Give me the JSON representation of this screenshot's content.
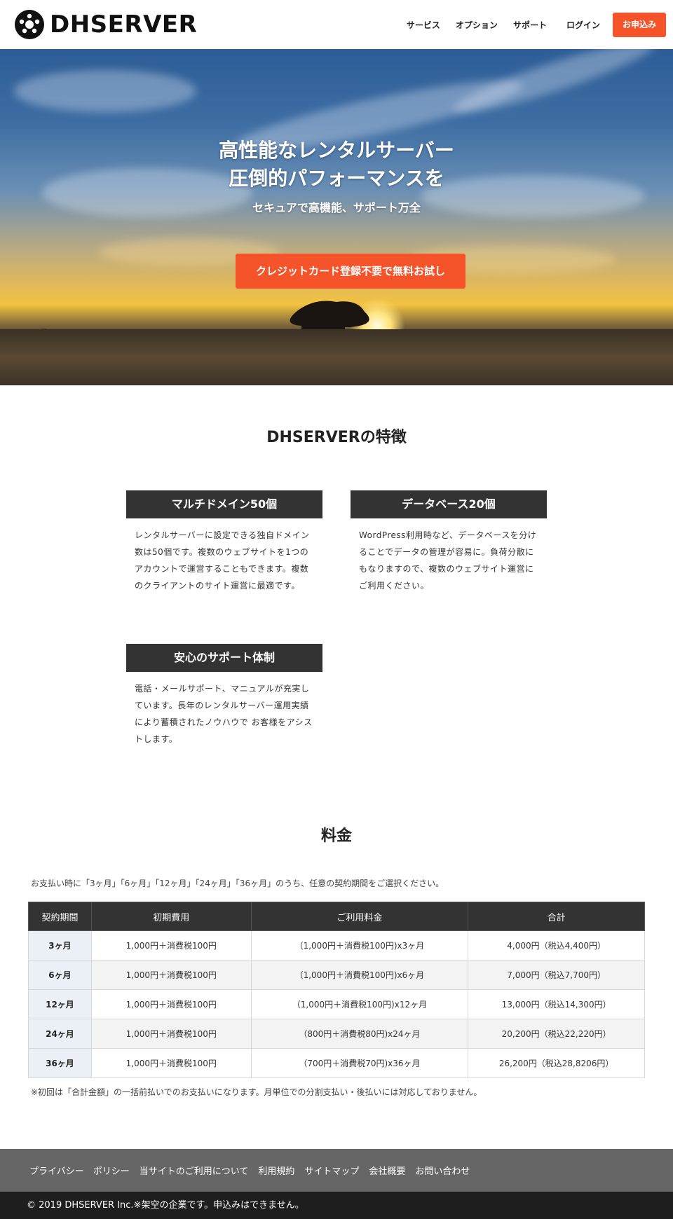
{
  "header": {
    "logo_text": "DHSERVER",
    "nav": [
      "サービス",
      "オプション",
      "サポート",
      "ログイン"
    ],
    "cta": "お申込み"
  },
  "hero": {
    "title_line1": "高性能なレンタルサーバー",
    "title_line2": "圧倒的パフォーマンスを",
    "subtitle": "セキュアで高機能、サポート万全",
    "button": "クレジットカード登録不要で無料お試し"
  },
  "features": {
    "title": "DHSERVERの特徴",
    "items": [
      {
        "heading": "マルチドメイン50個",
        "text": "レンタルサーバーに設定できる独自ドメイン数は50個です。複数のウェブサイトを1つのアカウントで運営することもできます。複数のクライアントのサイト運営に最適です。"
      },
      {
        "heading": "データベース20個",
        "text": "WordPress利用時など、データベースを分けることでデータの管理が容易に。負荷分散にもなりますので、複数のウェブサイト運営にご利用ください。"
      },
      {
        "heading": "安心のサポート体制",
        "text": "電話・メールサポート、マニュアルが充実しています。長年のレンタルサーバー運用実績により蓄積されたノウハウで お客様をアシストします。"
      }
    ]
  },
  "pricing": {
    "title": "料金",
    "note": "お支払い時に「3ヶ月」「6ヶ月」「12ヶ月」「24ヶ月」「36ヶ月」のうち、任意の契約期間をご選択ください。",
    "headers": [
      "契約期間",
      "初期費用",
      "ご利用料金",
      "合計"
    ],
    "rows": [
      [
        "3ヶ月",
        "1,000円＋消費税100円",
        "（1,000円＋消費税100円)x3ヶ月",
        "4,000円（税込4,400円）"
      ],
      [
        "6ヶ月",
        "1,000円＋消費税100円",
        "（1,000円＋消費税100円)x6ヶ月",
        "7,000円（税込7,700円）"
      ],
      [
        "12ヶ月",
        "1,000円＋消費税100円",
        "（1,000円＋消費税100円)x12ヶ月",
        "13,000円（税込14,300円）"
      ],
      [
        "24ヶ月",
        "1,000円＋消費税100円",
        "（800円＋消費税80円)x24ヶ月",
        "20,200円（税込22,220円）"
      ],
      [
        "36ヶ月",
        "1,000円＋消費税100円",
        "（700円＋消費税70円)x36ヶ月",
        "26,200円（税込28,8206円）"
      ]
    ],
    "footnote": "※初回は「合計金額」の一括前払いでのお支払いになります。月単位での分割支払い・後払いには対応しておりません。"
  },
  "footer": {
    "links": [
      "プライバシー　ポリシー",
      "当サイトのご利用について",
      "利用規約",
      "サイトマップ",
      "会社概要",
      "お問い合わせ"
    ],
    "copyright": "© 2019 DHSERVER Inc.※架空の企業です。申込みはできません。"
  },
  "colors": {
    "accent": "#f5532a",
    "dark": "#333333",
    "footer_links_bg": "#666666",
    "footer_bottom_bg": "#1e1e1e",
    "period_cell_bg": "#eaf0f5"
  },
  "icons": {
    "logo": "donut-logo-icon"
  }
}
